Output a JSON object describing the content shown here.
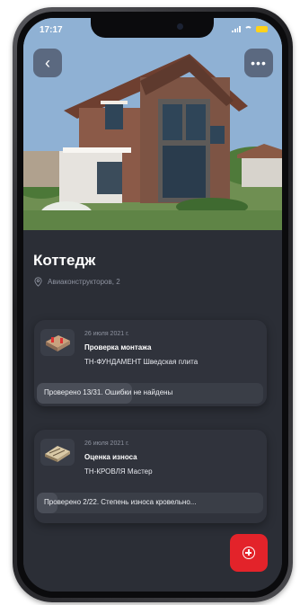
{
  "status_bar": {
    "time": "17:17"
  },
  "nav": {
    "back_glyph": "‹",
    "more_glyph": "•••"
  },
  "object": {
    "title": "Коттедж",
    "address": "Авиаконструкторов, 2"
  },
  "inspections": [
    {
      "date": "26 июля 2021 г.",
      "title": "Проверка монтажа",
      "product": "ТН-ФУНДАМЕНТ Шведская плита",
      "progress_text": "Проверено 13/31. Ошибки не найдены",
      "progress_fraction": 0.42,
      "thumbnail_icon": "foundation-model-icon"
    },
    {
      "date": "26 июля 2021 г.",
      "title": "Оценка износа",
      "product": "ТН-КРОВЛЯ Мастер",
      "progress_text": "Проверено 2/22. Степень износа кровельно...",
      "progress_fraction": 0.09,
      "thumbnail_icon": "roof-model-icon"
    }
  ],
  "colors": {
    "background": "#2b2e36",
    "card": "#30333c",
    "fab": "#e3232a",
    "battery": "#ffd21a"
  }
}
